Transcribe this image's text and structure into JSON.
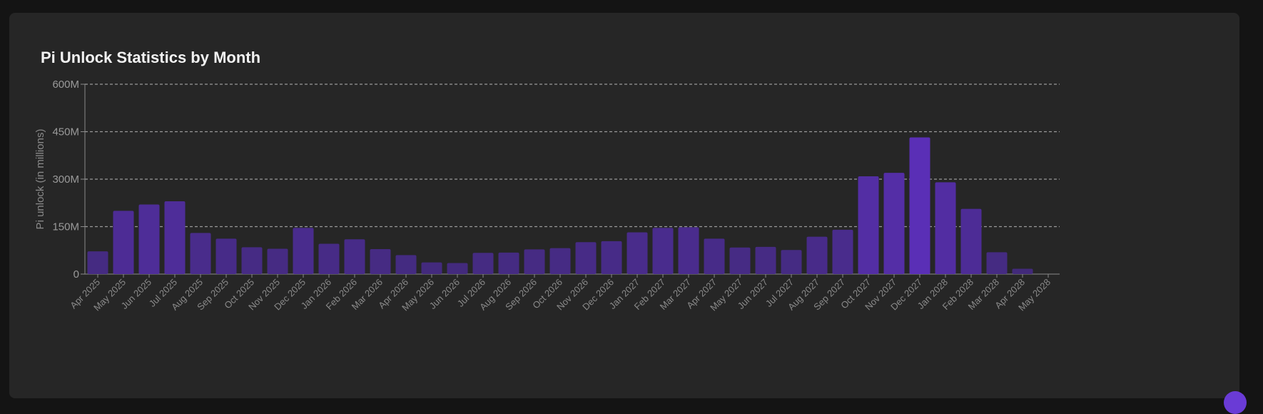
{
  "page": {
    "title": "Pi Unlock Statistics by Month"
  },
  "chart_data": {
    "type": "bar",
    "ylabel": "Pi unlock (in millions)",
    "ylim": [
      0,
      600
    ],
    "yticks": [
      0,
      150,
      300,
      450,
      600
    ],
    "ytick_labels": [
      "0",
      "150M",
      "300M",
      "450M",
      "600M"
    ],
    "grid": true,
    "colors": {
      "bar_low": "#412a78",
      "bar_high": "#5a2fb6",
      "grid": "#9a9a9a",
      "axis": "#8a8a8a"
    },
    "categories": [
      "Apr 2025",
      "May 2025",
      "Jun 2025",
      "Jul 2025",
      "Aug 2025",
      "Sep 2025",
      "Oct 2025",
      "Nov 2025",
      "Dec 2025",
      "Jan 2026",
      "Feb 2026",
      "Mar 2026",
      "Apr 2026",
      "May 2026",
      "Jun 2026",
      "Jul 2026",
      "Aug 2026",
      "Sep 2026",
      "Oct 2026",
      "Nov 2026",
      "Dec 2026",
      "Jan 2027",
      "Feb 2027",
      "Mar 2027",
      "Apr 2027",
      "May 2027",
      "Jun 2027",
      "Jul 2027",
      "Aug 2027",
      "Sep 2027",
      "Oct 2027",
      "Nov 2027",
      "Dec 2027",
      "Jan 2028",
      "Feb 2028",
      "Mar 2028",
      "Apr 2028",
      "May 2028"
    ],
    "values": [
      72,
      200,
      220,
      230,
      130,
      112,
      85,
      80,
      146,
      96,
      110,
      79,
      60,
      37,
      35,
      67,
      68,
      78,
      82,
      101,
      104,
      132,
      146,
      148,
      112,
      84,
      86,
      76,
      118,
      140,
      309,
      320,
      432,
      290,
      206,
      69,
      17,
      0
    ]
  }
}
